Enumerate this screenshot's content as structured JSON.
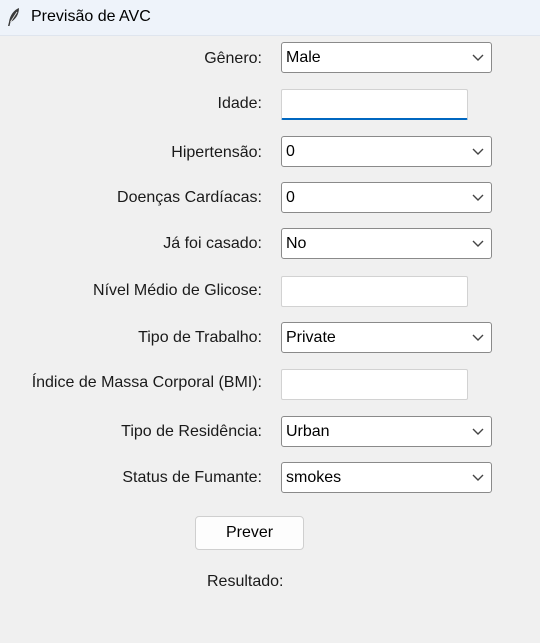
{
  "window": {
    "title": "Previsão de AVC",
    "icon": "feather-icon"
  },
  "form": {
    "genero": {
      "label": "Gênero:",
      "value": "Male"
    },
    "idade": {
      "label": "Idade:",
      "value": ""
    },
    "hipertensao": {
      "label": "Hipertensão:",
      "value": "0"
    },
    "doencas_cardiacas": {
      "label": "Doenças Cardíacas:",
      "value": "0"
    },
    "ja_foi_casado": {
      "label": "Já foi casado:",
      "value": "No"
    },
    "glicose": {
      "label": "Nível Médio de Glicose:",
      "value": ""
    },
    "tipo_trabalho": {
      "label": "Tipo de Trabalho:",
      "value": "Private"
    },
    "bmi": {
      "label": "Índice de Massa Corporal (BMI):",
      "value": ""
    },
    "tipo_residencia": {
      "label": "Tipo de Residência:",
      "value": "Urban"
    },
    "status_fumante": {
      "label": "Status de Fumante:",
      "value": "smokes"
    }
  },
  "actions": {
    "prever_label": "Prever"
  },
  "result": {
    "label": "Resultado:"
  },
  "colors": {
    "focus_accent": "#0067c0",
    "titlebar_bg": "#eef3fa",
    "window_bg": "#f0f0f0"
  }
}
